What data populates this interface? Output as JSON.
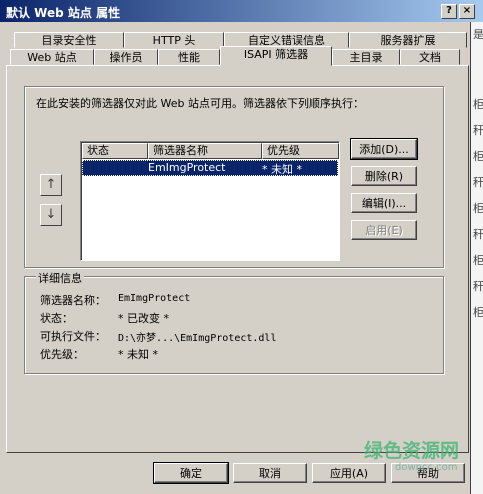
{
  "window": {
    "title": "默认 Web 站点 属性",
    "help_btn": "?",
    "close_btn": "×"
  },
  "tabs_row1": [
    "目录安全性",
    "HTTP 头",
    "自定义错误信息",
    "服务器扩展"
  ],
  "tabs_row2": [
    "Web 站点",
    "操作员",
    "性能",
    "ISAPI 筛选器",
    "主目录",
    "文档"
  ],
  "description": "在此安装的筛选器仅对此 Web 站点可用。筛选器依下列顺序执行：",
  "list": {
    "headers": [
      "状态",
      "筛选器名称",
      "优先级"
    ],
    "rows": [
      {
        "status": "",
        "name": "EmImgProtect",
        "priority": "* 未知 *"
      }
    ]
  },
  "side_buttons": {
    "add": "添加(D)...",
    "remove": "删除(R)",
    "edit": "编辑(I)...",
    "enable": "启用(E)"
  },
  "arrows": {
    "up": "↑",
    "down": "↓"
  },
  "details": {
    "title": "详细信息",
    "labels": [
      "筛选器名称：",
      "状态：",
      "可执行文件：",
      "优先级："
    ],
    "values": [
      "EmImgProtect",
      "* 已改变 *",
      "D:\\亦梦...\\EmImgProtect.dll",
      "* 未知 *"
    ]
  },
  "bottom_buttons": {
    "ok": "确定",
    "cancel": "取消",
    "apply": "应用(A)",
    "help": "帮助"
  },
  "watermark": {
    "text": "绿色资源网",
    "url": "downcc.com"
  },
  "background_glyphs": [
    "是",
    "柜",
    "秆",
    "柜",
    "秆",
    "柜",
    "秆",
    "柜",
    "秆",
    "柜"
  ]
}
